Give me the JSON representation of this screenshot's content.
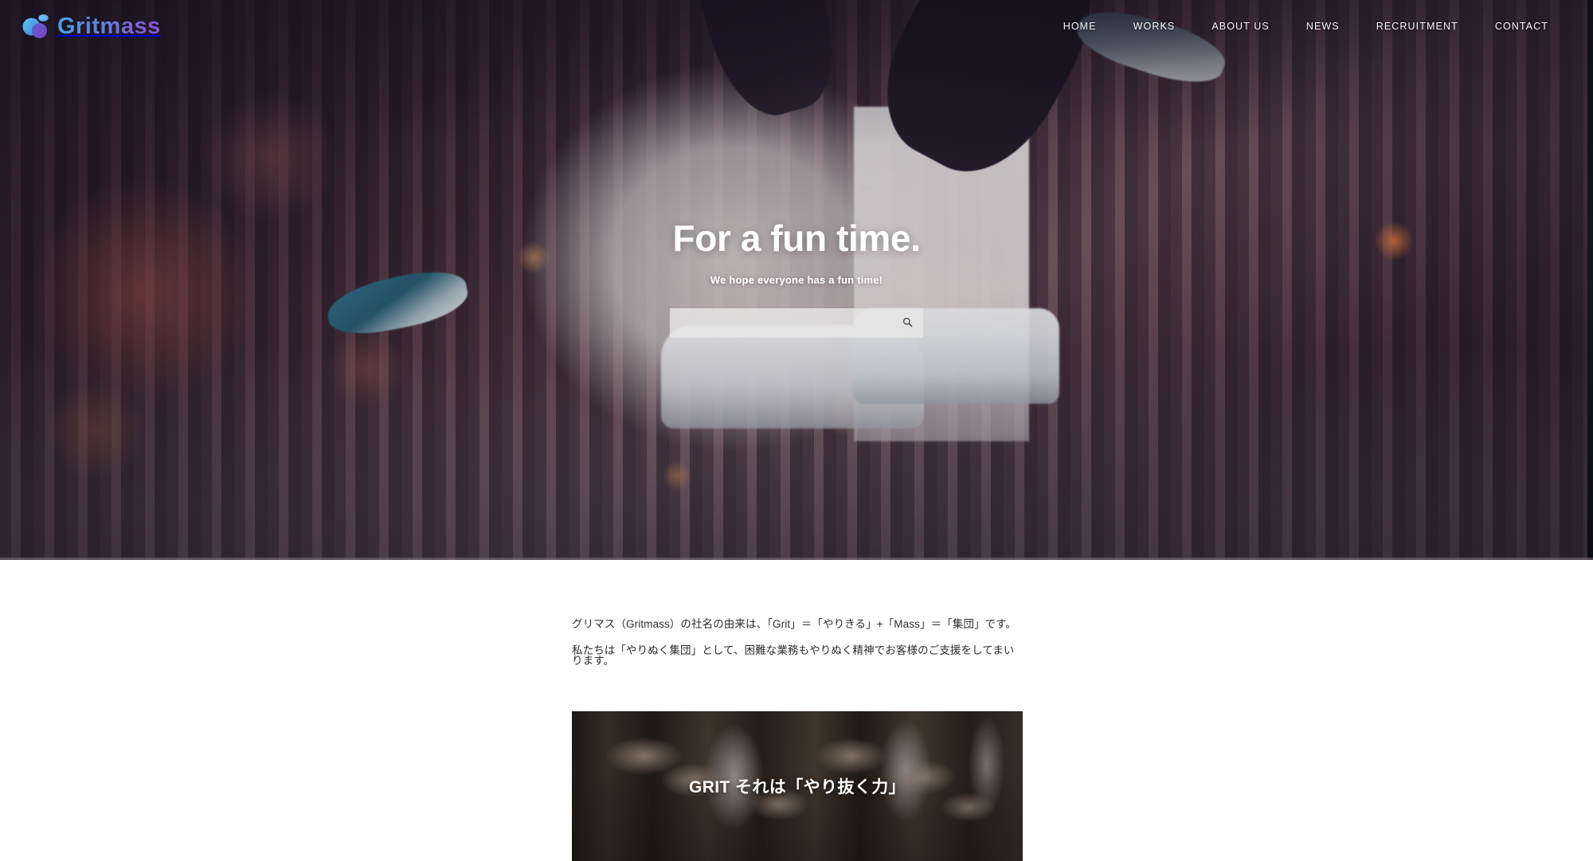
{
  "brand": {
    "name": "Gritmass",
    "logo_icon": "gritmass-droplet-logo",
    "gradient_start": "#4aa0e6",
    "gradient_end": "#8a55cf"
  },
  "nav": {
    "items": [
      {
        "label": "HOME",
        "name": "nav-item-home"
      },
      {
        "label": "WORKS",
        "name": "nav-item-works"
      },
      {
        "label": "ABOUT US",
        "name": "nav-item-about-us"
      },
      {
        "label": "NEWS",
        "name": "nav-item-news"
      },
      {
        "label": "RECRUITMENT",
        "name": "nav-item-recruitment"
      },
      {
        "label": "CONTACT",
        "name": "nav-item-contact"
      }
    ]
  },
  "hero": {
    "title": "For a fun time.",
    "subtitle": "We hope everyone has a fun time!",
    "background_description": "city street at dusk with jumping person's sneakers",
    "search": {
      "value": "",
      "placeholder": "",
      "icon": "search-icon"
    }
  },
  "main": {
    "paragraphs": [
      "グリマス（Gritmass）の社名の由来は、「Grit」＝「やりきる」+「Mass」＝「集団」です。",
      "私たちは「やりぬく集団」として、困難な業務もやりぬく精神でお客様のご支援をしてまいります。"
    ],
    "banner": {
      "caption": "GRIT それは「やり抜く力」",
      "image_description": "business team reaching hands together over a desk"
    }
  }
}
